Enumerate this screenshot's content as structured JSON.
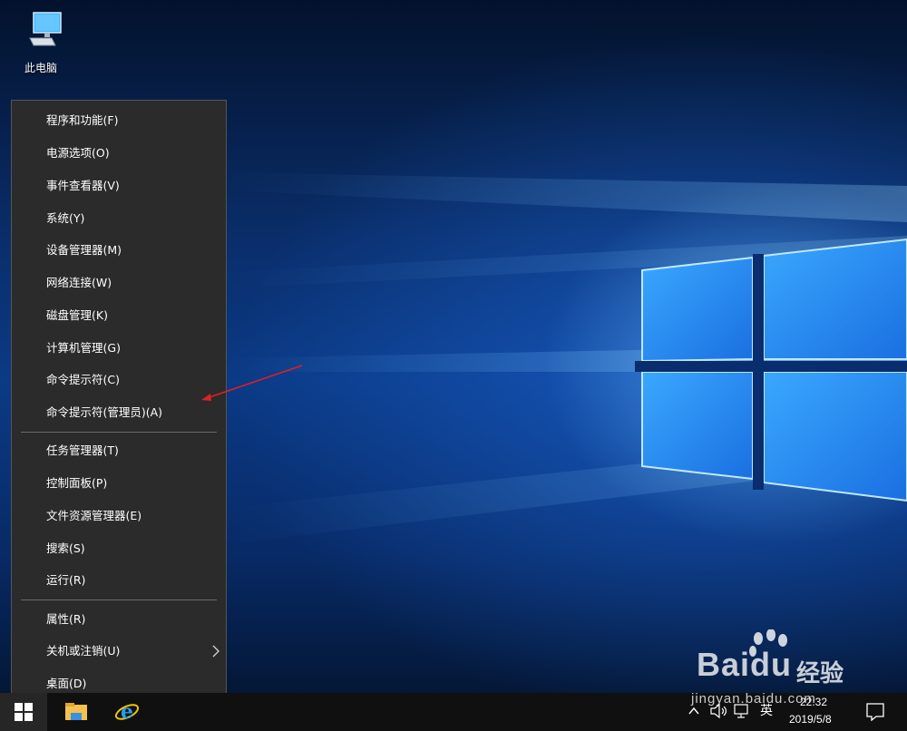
{
  "desktop": {
    "icons": [
      {
        "label": "此电脑",
        "icon": "this-pc-monitor-icon"
      }
    ]
  },
  "winx_menu": {
    "groups": [
      [
        {
          "label": "程序和功能(F)"
        },
        {
          "label": "电源选项(O)"
        },
        {
          "label": "事件查看器(V)"
        },
        {
          "label": "系统(Y)"
        },
        {
          "label": "设备管理器(M)"
        },
        {
          "label": "网络连接(W)"
        },
        {
          "label": "磁盘管理(K)"
        },
        {
          "label": "计算机管理(G)"
        },
        {
          "label": "命令提示符(C)"
        },
        {
          "label": "命令提示符(管理员)(A)",
          "highlighted_by_annotation": true
        }
      ],
      [
        {
          "label": "任务管理器(T)"
        },
        {
          "label": "控制面板(P)"
        },
        {
          "label": "文件资源管理器(E)"
        },
        {
          "label": "搜索(S)"
        },
        {
          "label": "运行(R)"
        }
      ],
      [
        {
          "label": "属性(R)"
        },
        {
          "label": "关机或注销(U)",
          "has_submenu": true,
          "submenu_icon": "chevron-right-icon"
        },
        {
          "label": "桌面(D)"
        }
      ]
    ]
  },
  "annotation": {
    "color": "#e02020",
    "points_to": "命令提示符(管理员)(A)"
  },
  "taskbar": {
    "start_icon": "windows-logo-icon",
    "pinned_apps": [
      {
        "name": "file-explorer",
        "icon": "folder-icon"
      },
      {
        "name": "internet-explorer",
        "icon": "ie-icon"
      }
    ],
    "tray": {
      "icons": [
        "chevron-up-icon",
        "volume-icon",
        "network-icon"
      ],
      "language": "英",
      "time": "22:32",
      "date": "2019/5/8",
      "notification_icon": "action-center-icon"
    }
  },
  "watermark": {
    "brand": "Bai",
    "brand_suffix": "du",
    "cn": "经验",
    "url": "jingyan.baidu.com"
  },
  "colors": {
    "menu_bg": "#2b2b2b",
    "menu_text": "#ffffff",
    "taskbar_bg": "#101010",
    "accent": "#2f8cff"
  }
}
